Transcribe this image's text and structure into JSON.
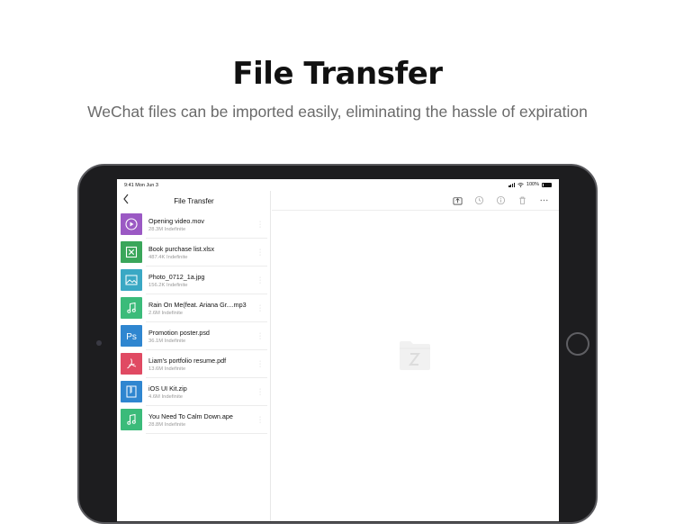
{
  "header": {
    "title": "File Transfer",
    "subtitle": "WeChat files can be imported easily, eliminating the hassle of expiration"
  },
  "status_bar": {
    "time": "9:41  Mon Jun 3",
    "battery": "100%"
  },
  "sidebar": {
    "title": "File Transfer",
    "back_icon": "chevron-left-icon",
    "files": [
      {
        "name": "Opening video.mov",
        "meta": "28.3M Indefinite",
        "icon": "video-play-icon",
        "color": "#9b59c4"
      },
      {
        "name": "Book purchase list.xlsx",
        "meta": "487.4K Indefinite",
        "icon": "excel-icon",
        "color": "#3aa65a"
      },
      {
        "name": "Photo_0712_1a.jpg",
        "meta": "156.2K Indefinite",
        "icon": "image-icon",
        "color": "#3aa8c4"
      },
      {
        "name": "Rain On Me(feat. Ariana Gr....mp3",
        "meta": "2.6M Indefinite",
        "icon": "music-note-icon",
        "color": "#3bbb7a"
      },
      {
        "name": "Promotion poster.psd",
        "meta": "36.1M Indefinite",
        "icon": "photoshop-icon",
        "color": "#2f86d0"
      },
      {
        "name": "Liam's portfolio resume.pdf",
        "meta": "13.6M Indefinite",
        "icon": "pdf-icon",
        "color": "#e04a63"
      },
      {
        "name": "iOS UI Kit.zip",
        "meta": "4.6M Indefinite",
        "icon": "zip-archive-icon",
        "color": "#2f86d0"
      },
      {
        "name": "You Need To Calm Down.ape",
        "meta": "28.8M Indefinite",
        "icon": "music-note-icon",
        "color": "#3bbb7a"
      }
    ]
  },
  "toolbar": {
    "icons": [
      "export-icon",
      "clock-icon",
      "info-icon",
      "trash-icon",
      "more-icon"
    ]
  },
  "main": {
    "placeholder_icon": "empty-folder-icon"
  }
}
